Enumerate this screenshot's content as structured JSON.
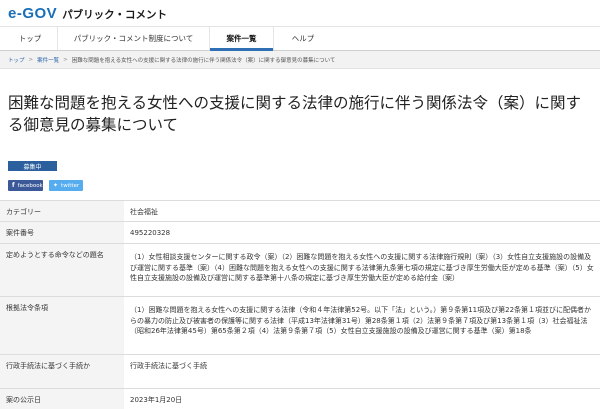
{
  "header": {
    "logo": "e-GOV",
    "site_name": "パブリック・コメント"
  },
  "nav": {
    "items": [
      {
        "label": "トップ"
      },
      {
        "label": "パブリック・コメント制度について"
      },
      {
        "label": "案件一覧"
      },
      {
        "label": "ヘルプ"
      }
    ]
  },
  "breadcrumb": {
    "home": "トップ",
    "list": "案件一覧",
    "current": "困難な問題を抱える女性への支援に関する法律の施行に伴う関係法令（案）に関する御意見の募集について"
  },
  "page": {
    "title": "困難な問題を抱える女性への支援に関する法律の施行に伴う関係法令（案）に関する御意見の募集について",
    "status": "募集中"
  },
  "share": {
    "facebook": "facebook",
    "twitter": "twitter"
  },
  "details": {
    "category": {
      "label": "カテゴリー",
      "value": "社会福祉"
    },
    "case_number": {
      "label": "案件番号",
      "value": "495220328"
    },
    "order_names": {
      "label": "定めようとする命令などの題名",
      "value": "（1）女性相談支援センターに関する政令（案）（2）困難な問題を抱える女性への支援に関する法律施行規則（案）（3）女性自立支援施設の設備及び運営に関する基準（案）（4）困難な問題を抱える女性への支援に関する法律第九条第七項の規定に基づき厚生労働大臣が定める基準（案）（5）女性自立支援施設の設備及び運営に関する基準第十八条の規定に基づき厚生労働大臣が定める給付金（案）"
    },
    "basis_law": {
      "label": "根拠法令条項",
      "value": "（1）困難な問題を抱える女性への支援に関する法律（令和４年法律第52号。以下「法」という。）第９条第11項及び第22条第１項並びに配偶者からの暴力の防止及び被害者の保護等に関する法律（平成13年法律第31号）第28条第１項（2）法第９条第７項及び第13条第１項（3）社会福祉法（昭和26年法律第45号）第65条第２項（4）法第９条第７項（5）女性自立支援施設の設備及び運営に関する基準（案）第18条"
    },
    "admin_procedure": {
      "label": "行政手続法に基づく手続か",
      "value": "行政手続法に基づく手続"
    },
    "announce_date": {
      "label": "案の公示日",
      "value": "2023年1月20日"
    }
  }
}
